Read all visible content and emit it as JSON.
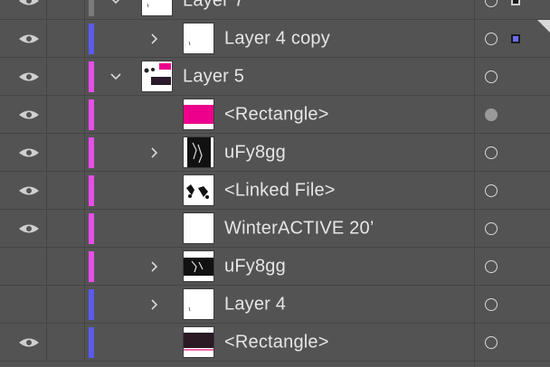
{
  "layers_panel": {
    "rows": [
      {
        "label": "Layer 7",
        "visible": true,
        "color": "#7a7a7a",
        "indent": 1,
        "chevron": "down",
        "thumb": "white-mark",
        "target": "ring",
        "selection": "#1a1a1a"
      },
      {
        "label": "Layer 4 copy",
        "visible": true,
        "color": "#5a5aef",
        "indent": 2,
        "chevron": "right",
        "thumb": "white-mark",
        "target": "ring",
        "selection": "#6b6bff"
      },
      {
        "label": "Layer 5",
        "visible": true,
        "color": "#e84de8",
        "indent": 1,
        "chevron": "down",
        "thumb": "layer5",
        "target": "ring"
      },
      {
        "label": "<Rectangle>",
        "visible": true,
        "color": "#e84de8",
        "indent": 3,
        "thumb": "magenta",
        "target": "filled"
      },
      {
        "label": "uFy8gg",
        "visible": true,
        "color": "#e84de8",
        "indent": 2,
        "chevron": "right",
        "thumb": "photo-tall",
        "target": "ring"
      },
      {
        "label": "<Linked File>",
        "visible": true,
        "color": "#e84de8",
        "indent": 3,
        "thumb": "photo-small",
        "target": "ring"
      },
      {
        "label": "WinterACTIVE 20’",
        "visible": true,
        "color": "#e84de8",
        "indent": 3,
        "thumb": "white",
        "target": "ring"
      },
      {
        "label": "uFy8gg",
        "visible": false,
        "color": "#e84de8",
        "indent": 2,
        "chevron": "right",
        "thumb": "photo-wide",
        "target": "ring"
      },
      {
        "label": "Layer 4",
        "visible": false,
        "color": "#5a5aef",
        "indent": 2,
        "chevron": "right",
        "thumb": "white-mark",
        "target": "ring"
      },
      {
        "label": "<Rectangle>",
        "visible": true,
        "color": "#5a5aef",
        "indent": 3,
        "thumb": "dark-rect",
        "target": "ring"
      }
    ]
  }
}
